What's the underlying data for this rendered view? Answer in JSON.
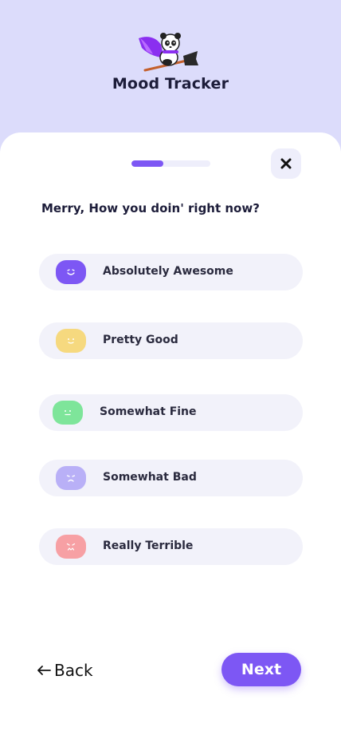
{
  "app": {
    "title": "Mood Tracker"
  },
  "progress": {
    "value": 0.4
  },
  "question": "Merry, How you doin' right now?",
  "options": [
    {
      "label": "Absolutely Awesome",
      "color": "#7d57f4",
      "icon": "grinning-face-icon"
    },
    {
      "label": "Pretty Good",
      "color": "#f6d97f",
      "icon": "smiling-face-icon"
    },
    {
      "label": "Somewhat Fine",
      "color": "#7ee59a",
      "icon": "neutral-face-icon"
    },
    {
      "label": "Somewhat Bad",
      "color": "#b9b0f7",
      "icon": "sad-face-icon"
    },
    {
      "label": "Really Terrible",
      "color": "#f7a0a4",
      "icon": "crying-face-icon"
    }
  ],
  "nav": {
    "back_label": "Back",
    "next_label": "Next"
  },
  "colors": {
    "accent": "#7d57f4",
    "header_bg": "#dcdcfb",
    "option_bg": "#f2f2fa"
  }
}
